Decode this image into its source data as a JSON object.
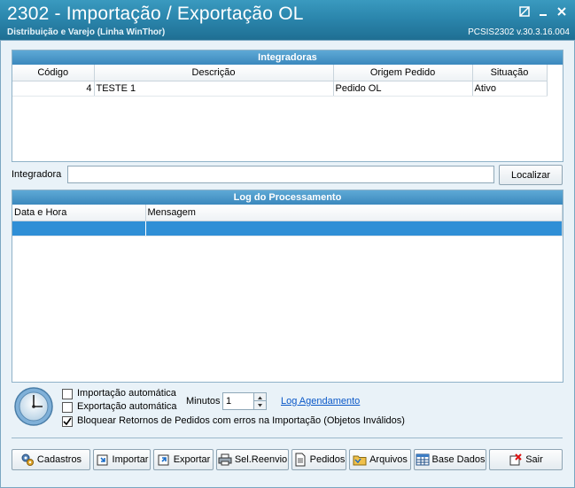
{
  "window": {
    "title": "2302 - Importação / Exportação OL",
    "subtitle": "Distribuição e Varejo (Linha WinThor)",
    "version": "PCSIS2302  v.30.3.16.004"
  },
  "integradoras": {
    "header": "Integradoras",
    "columns": [
      "Código",
      "Descrição",
      "Origem Pedido",
      "Situação"
    ],
    "rows": [
      {
        "codigo": "4",
        "descricao": "TESTE 1",
        "origem": "Pedido OL",
        "situacao": "Ativo"
      }
    ]
  },
  "search": {
    "label": "Integradora",
    "value": "",
    "button": "Localizar"
  },
  "log": {
    "header": "Log do Processamento",
    "columns": [
      "Data e Hora",
      "Mensagem"
    ]
  },
  "options": {
    "import_auto": {
      "label": "Importação automática",
      "checked": false
    },
    "export_auto": {
      "label": "Exportação automática",
      "checked": false
    },
    "block_returns": {
      "label": "Bloquear Retornos de Pedidos com erros na Importação (Objetos Inválidos)",
      "checked": true
    },
    "minutes_label": "Minutos",
    "minutes_value": "1",
    "log_link": "Log Agendamento"
  },
  "toolbar": {
    "cadastros": "Cadastros",
    "importar": "Importar",
    "exportar": "Exportar",
    "sel_reenvio": "Sel.Reenvio",
    "pedidos": "Pedidos",
    "arquivos": "Arquivos",
    "base_dados": "Base Dados",
    "sair": "Sair"
  }
}
